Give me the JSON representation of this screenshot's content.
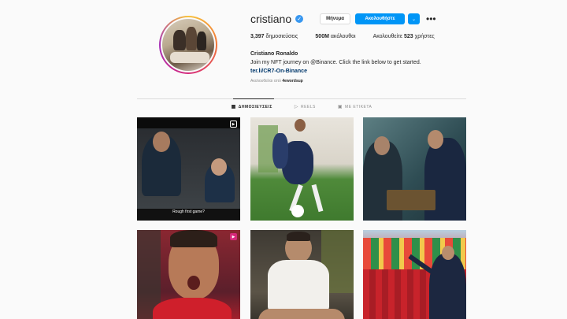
{
  "profile": {
    "username": "cristiano",
    "message_button": "Μήνυμα",
    "follow_button": "Ακολουθήστε",
    "stats": {
      "posts_count": "3,397",
      "posts_label": "δημοσιεύσεις",
      "followers_count": "500M",
      "followers_label": "ακόλουθοι",
      "following_label": "Ακολουθείτε",
      "following_count": "523",
      "following_suffix": "χρήστες"
    },
    "bio": {
      "name": "Cristiano Ronaldo",
      "text": "Join my NFT journey on @Binance. Click the link below to get started.",
      "link": "ter.li/CR7-On-Binance"
    },
    "followed_by_label": "Ακολουθείται από",
    "followed_by_user": "4ewordsup"
  },
  "tabs": [
    {
      "label": "ΔΗΜΟΣΙΕΥΣΕΙΣ",
      "icon": "grid-icon",
      "active": true
    },
    {
      "label": "REELS",
      "icon": "reels-icon",
      "active": false
    },
    {
      "label": "ΜΕ ΕΤΙΚΕΤΑ",
      "icon": "tagged-icon",
      "active": false
    }
  ],
  "posts": [
    {
      "caption": "Rough first game?",
      "type": "reel"
    },
    {
      "caption": "",
      "type": "photo"
    },
    {
      "caption": "",
      "type": "photo"
    },
    {
      "caption": "",
      "type": "reel"
    },
    {
      "caption": "",
      "type": "photo"
    },
    {
      "caption": "",
      "type": "photo"
    }
  ],
  "colors": {
    "accent": "#0095f6",
    "link": "#00376b",
    "verified": "#3897f0",
    "background": "#fafafa"
  }
}
